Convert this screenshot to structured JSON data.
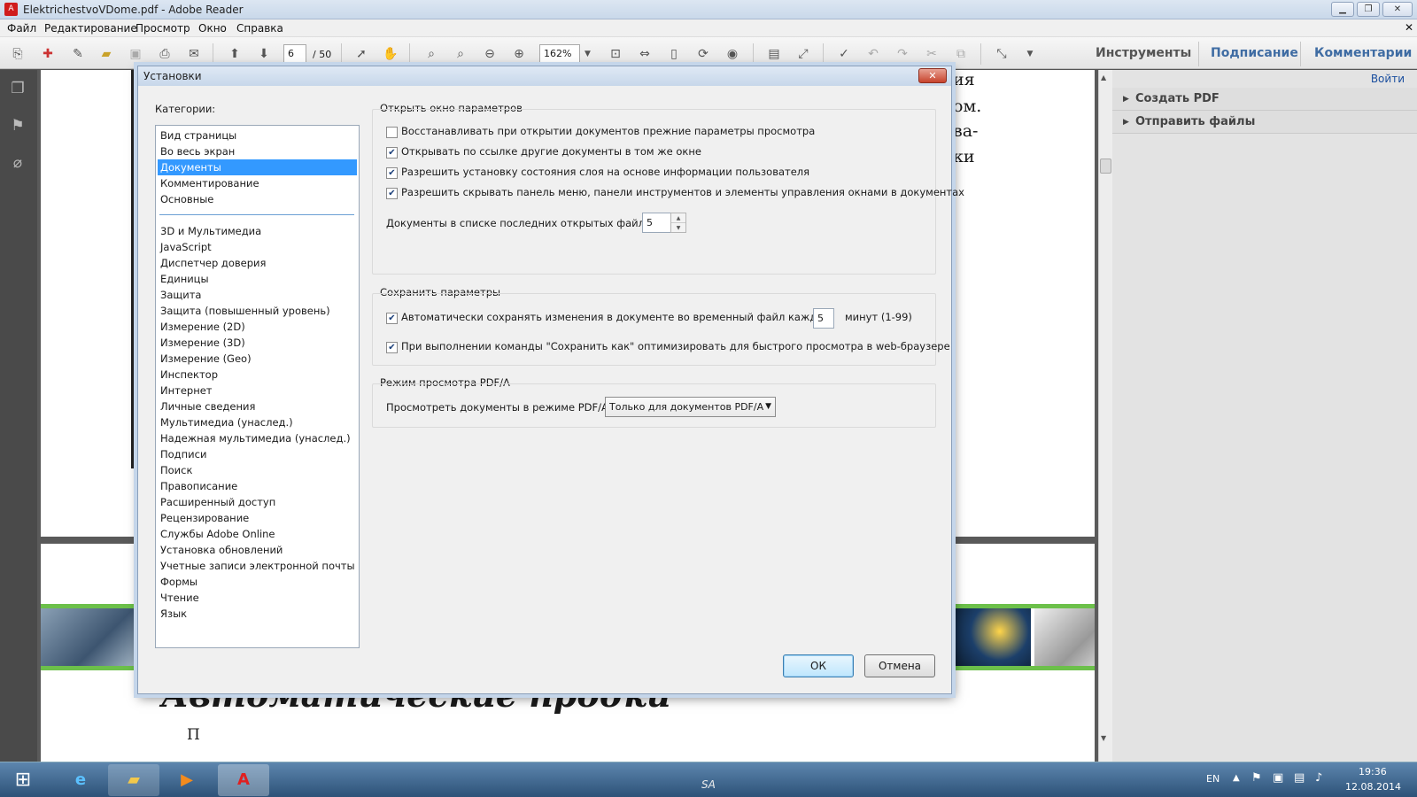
{
  "window": {
    "title": "ElektrichestvoVDome.pdf - Adobe Reader"
  },
  "menu": [
    "Файл",
    "Редактирование",
    "Просмотр",
    "Окно",
    "Справка"
  ],
  "toolbar": {
    "page_current": "6",
    "page_total": "/ 50",
    "zoom": "162%"
  },
  "right_tabs": {
    "tools": "Инструменты",
    "sign": "Подписание",
    "comments": "Комментарии"
  },
  "right_panel": {
    "login": "Войти",
    "create_pdf": "Создать PDF",
    "send_files": "Отправить файлы"
  },
  "document": {
    "fragments": [
      "ия",
      "ом.",
      "ва-",
      "ки"
    ],
    "heading": "Автоматические  пробки",
    "trailing_text": "П"
  },
  "dialog": {
    "title": "Установки",
    "categories_label": "Категории:",
    "categories_top": [
      "Вид страницы",
      "Во весь экран",
      "Документы",
      "Комментирование",
      "Основные"
    ],
    "categories": [
      "3D и Мультимедиа",
      "JavaScript",
      "Диспетчер доверия",
      "Единицы",
      "Защита",
      "Защита (повышенный уровень)",
      "Измерение (2D)",
      "Измерение (3D)",
      "Измерение (Geo)",
      "Инспектор",
      "Интернет",
      "Личные сведения",
      "Мультимедиа (унаслед.)",
      "Надежная мультимедиа (унаслед.)",
      "Подписи",
      "Поиск",
      "Правописание",
      "Расширенный доступ",
      "Рецензирование",
      "Службы Adobe Online",
      "Установка обновлений",
      "Учетные записи электронной почты",
      "Формы",
      "Чтение",
      "Язык"
    ],
    "selected_category": "Документы",
    "open_group": {
      "title": "Открыть окно параметров",
      "checks": [
        {
          "label": "Восстанавливать при открытии документов прежние параметры просмотра",
          "checked": false
        },
        {
          "label": "Открывать по ссылке другие документы в том же окне",
          "checked": true
        },
        {
          "label": "Разрешить установку состояния слоя на основе информации пользователя",
          "checked": true
        },
        {
          "label": "Разрешить скрывать панель меню, панели инструментов и элементы управления окнами в документах",
          "checked": true
        }
      ],
      "recent_label": "Документы в списке последних открытых файлов:",
      "recent_value": "5"
    },
    "save_group": {
      "title": "Сохранить параметры",
      "autosave_label": "Автоматически сохранять изменения в документе во временный файл каждые:",
      "autosave_checked": true,
      "autosave_value": "5",
      "autosave_unit": "минут (1-99)",
      "optimize_label": "При выполнении команды \"Сохранить как\" оптимизировать для быстрого просмотра в web-браузере",
      "optimize_checked": true
    },
    "pdfa_group": {
      "title": "Режим просмотра PDF/A",
      "label": "Просмотреть документы в режиме PDF/A:",
      "value": "Только для документов PDF/A"
    },
    "ok": "ОК",
    "cancel": "Отмена"
  },
  "taskbar": {
    "lang": "EN",
    "time": "19:36",
    "date": "12.08.2014",
    "sa": "SA"
  },
  "colors": {
    "selection": "#3399ff",
    "pdf_red": "#d01c1c",
    "green_band": "#6cc04a"
  }
}
